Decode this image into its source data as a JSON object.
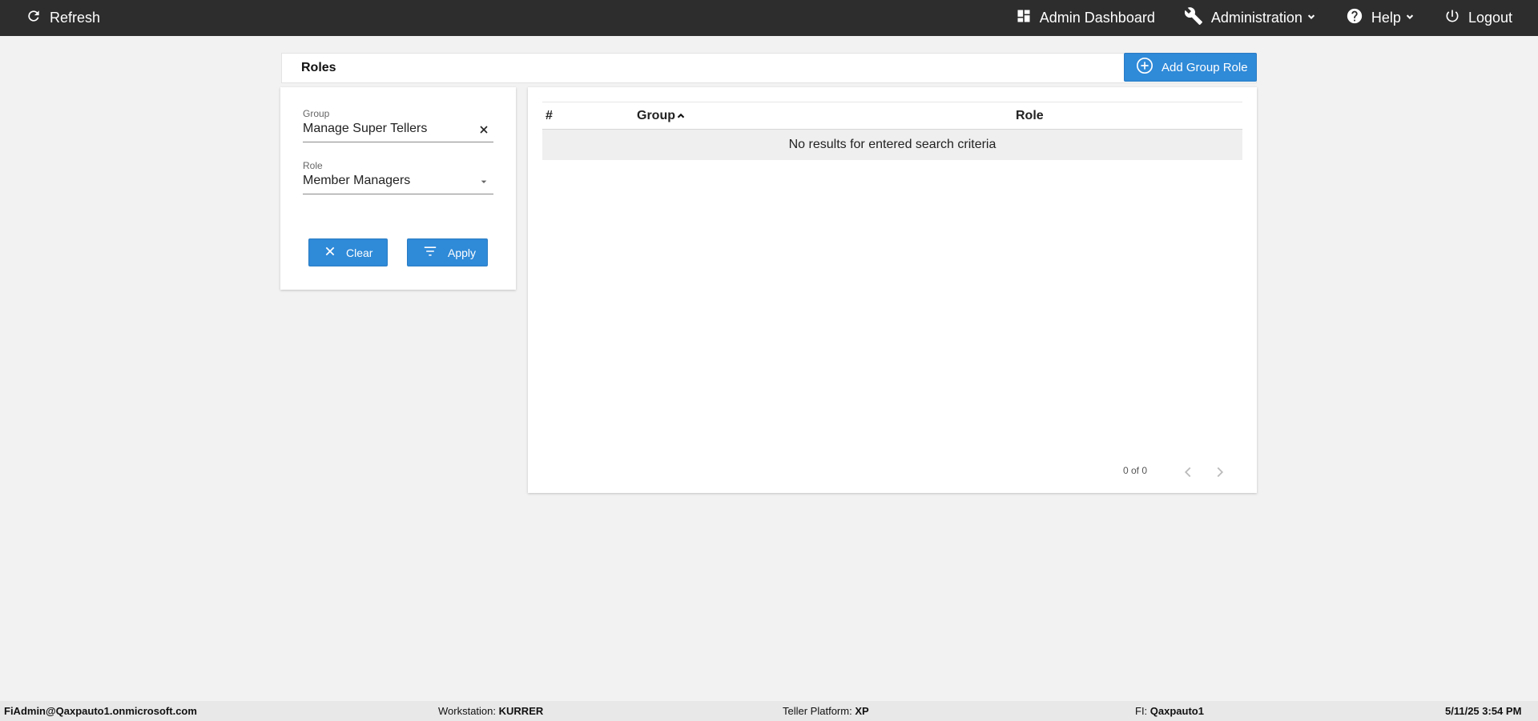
{
  "header": {
    "refresh_label": "Refresh",
    "nav": [
      {
        "label": "Admin Dashboard",
        "icon": "dashboard-icon"
      },
      {
        "label": "Administration",
        "icon": "wrench-icon",
        "has_dropdown": true
      },
      {
        "label": "Help",
        "icon": "help-icon",
        "has_dropdown": true
      },
      {
        "label": "Logout",
        "icon": "power-icon"
      }
    ]
  },
  "page": {
    "title": "Roles",
    "add_button_label": "Add Group Role"
  },
  "filters": {
    "group": {
      "label": "Group",
      "value": "Manage Super Tellers"
    },
    "role": {
      "label": "Role",
      "value": "Member Managers"
    },
    "clear_label": "Clear",
    "apply_label": "Apply"
  },
  "table": {
    "columns": [
      "#",
      "Group",
      "Role"
    ],
    "sort_column": "Group",
    "sort_direction": "ascending",
    "empty_message": "No results for entered search criteria",
    "pager_text": "0 of 0"
  },
  "footer": {
    "user": "FiAdmin@Qaxpauto1.onmicrosoft.com",
    "workstation_label": "Workstation:",
    "workstation_value": "KURRER",
    "platform_label": "Teller Platform:",
    "platform_value": "XP",
    "fi_label": "FI:",
    "fi_value": "Qaxpauto1",
    "datetime": "5/11/25 3:54 PM"
  },
  "colors": {
    "topbar": "#2d2d2d",
    "accent": "#2f8ad8",
    "background": "#f2f2f2"
  }
}
